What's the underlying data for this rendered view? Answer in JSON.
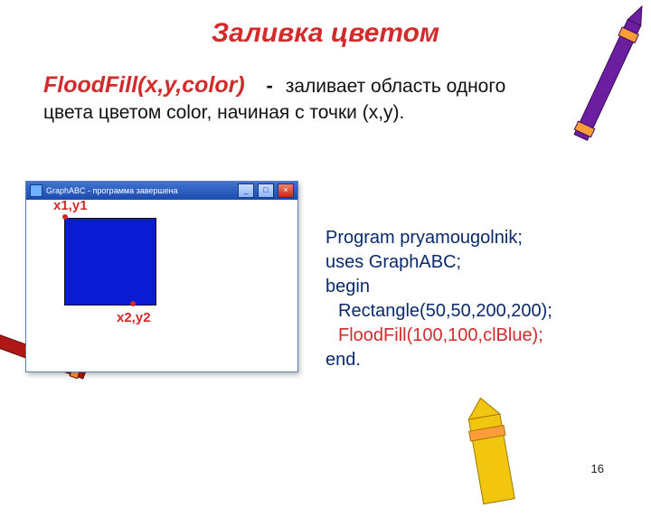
{
  "title": "Заливка цветом",
  "fn_signature": "FloodFill(x,y,color)",
  "desc_dash": "-",
  "description": "заливает область одного цвета цветом color, начиная с точки (x,y).",
  "window": {
    "title": "GraphABC - программа завершена",
    "min": "_",
    "max": "□",
    "close": "×",
    "pt1": "x1,y1",
    "pt2": "x2,y2"
  },
  "code": {
    "l1": "Program pryamougolnik;",
    "l2": "uses GraphABC;",
    "l3": "begin",
    "l4": "Rectangle(50,50,200,200);",
    "l5": "FloodFill(100,100,clBlue);",
    "l6": "end."
  },
  "page_number": "16",
  "decor": {
    "crayon1": "purple-crayon",
    "crayon2": "red-crayon",
    "crayon3": "yellow-crayon"
  }
}
